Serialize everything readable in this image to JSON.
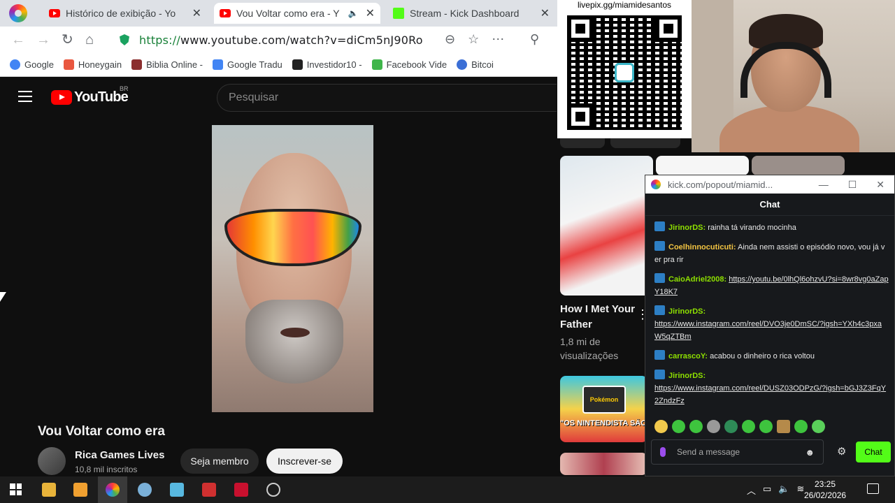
{
  "browser": {
    "tabs": [
      {
        "title": "Histórico de exibição - Yo",
        "active": false
      },
      {
        "title": "Vou Voltar como era - Y",
        "active": true
      },
      {
        "title": "Stream - Kick Dashboard",
        "active": false
      }
    ],
    "url_scheme": "https://",
    "url_rest": "www.youtube.com/watch?v=diCm5nJ90Ro",
    "bookmarks": [
      "Google",
      "Honeygain",
      "Biblia Online -",
      "Google Tradu",
      "Investidor10 -",
      "Facebook Vide",
      "Bitcoi"
    ]
  },
  "youtube": {
    "logo_word": "YouTube",
    "country": "BR",
    "search_placeholder": "Pesquisar",
    "video_title": "Vou Voltar como era",
    "channel_name": "Rica Games Lives",
    "subscribers": "10,8 mil inscritos",
    "member_button": "Seja membro",
    "subscribe_button": "Inscrever-se",
    "recommendation": {
      "title": "How I Met Your Father",
      "views": "1,8 mi de visualizações"
    },
    "thumb_text": "\"OS NINTENDISTA SÃO MUITO IMBE",
    "thumb_logo": "Pokémon"
  },
  "overlay": {
    "qr_label": "livepix.gg/miamidesantos"
  },
  "chat_window": {
    "title": "kick.com/popout/miamid...",
    "header": "Chat",
    "messages": [
      {
        "user": "JirinorDS:",
        "user_color": "#8ee000",
        "text": " rainha tá virando mocinha",
        "link": ""
      },
      {
        "user": "Coelhinnocuticuti:",
        "user_color": "#f4c542",
        "text": " Ainda nem assisti o episódio novo, vou já ver pra rir",
        "link": ""
      },
      {
        "user": "CaioAdriel2008:",
        "user_color": "#8ee000",
        "text": " ",
        "link": "https://youtu.be/0lhQl6ohzvU?si=8wr8vg0aZapY18K7"
      },
      {
        "user": "JirinorDS:",
        "user_color": "#8ee000",
        "text": " ",
        "link": "https://www.instagram.com/reel/DVO3je0DmSC/?igsh=YXh4c3pxaW5qZTBm"
      },
      {
        "user": "carrascoY:",
        "user_color": "#8ee000",
        "text": " acabou o dinheiro o rica voltou",
        "link": ""
      },
      {
        "user": "JirinorDS:",
        "user_color": "#8ee000",
        "text": " ",
        "link": "https://www.instagram.com/reel/DUSZ03ODPzG/?igsh=bGJ3Z3FqY2ZndzFz"
      }
    ],
    "input_placeholder": "Send a message",
    "send_button": "Chat"
  },
  "taskbar": {
    "time": "23:25",
    "date": "26/02/2026"
  },
  "colors": {
    "youtube_red": "#ff0000",
    "kick_green": "#53fc18",
    "url_green": "#188038"
  }
}
